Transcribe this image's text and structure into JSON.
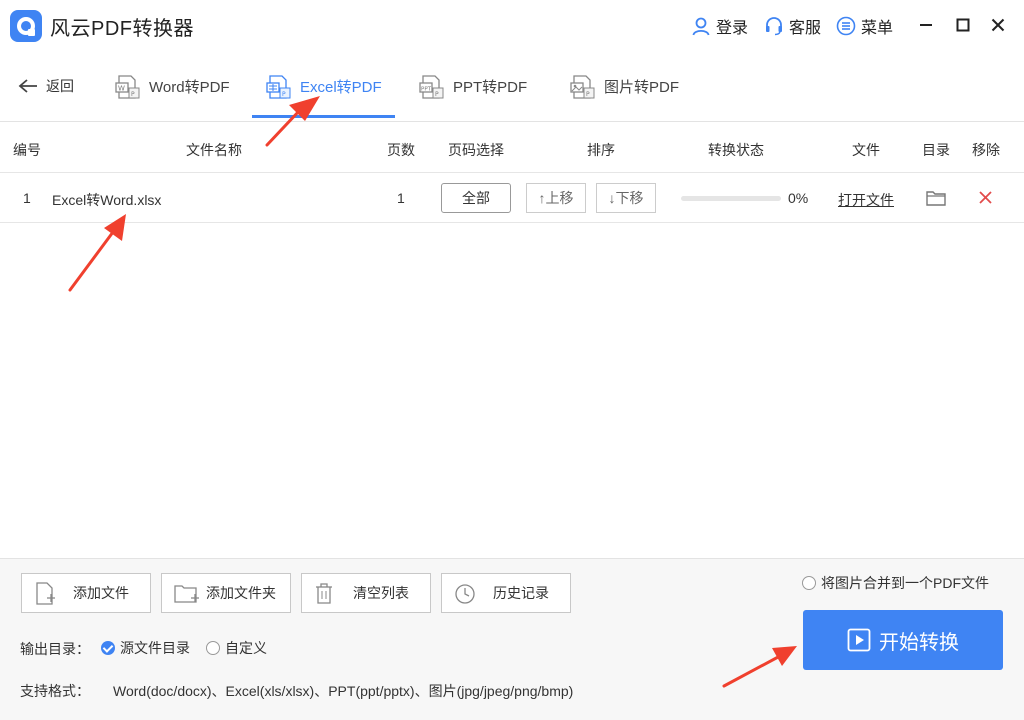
{
  "app": {
    "title": "风云PDF转换器"
  },
  "header": {
    "login": "登录",
    "service": "客服",
    "menu": "菜单"
  },
  "nav": {
    "back": "返回",
    "tabs": [
      {
        "label": "Word转PDF",
        "icon": "word-doc-icon",
        "active": false
      },
      {
        "label": "Excel转PDF",
        "icon": "excel-doc-icon",
        "active": true
      },
      {
        "label": "PPT转PDF",
        "icon": "ppt-doc-icon",
        "active": false
      },
      {
        "label": "图片转PDF",
        "icon": "image-doc-icon",
        "active": false
      }
    ]
  },
  "table": {
    "headers": {
      "index": "编号",
      "name": "文件名称",
      "pages": "页数",
      "page_select": "页码选择",
      "order": "排序",
      "status": "转换状态",
      "file": "文件",
      "dir": "目录",
      "remove": "移除"
    },
    "rows": [
      {
        "index": "1",
        "name": "Excel转Word.xlsx",
        "pages": "1",
        "page_select": "全部",
        "move_up": "↑上移",
        "move_down": "↓下移",
        "progress": 0,
        "progress_text": "0%",
        "open_file": "打开文件"
      }
    ]
  },
  "bottom": {
    "add_file": "添加文件",
    "add_folder": "添加文件夹",
    "clear_list": "清空列表",
    "history": "历史记录",
    "output_label": "输出目录：",
    "output_source": "源文件目录",
    "output_custom": "自定义",
    "formats_label": "支持格式：",
    "formats": "Word(doc/docx)、Excel(xls/xlsx)、PPT(ppt/pptx)、图片(jpg/jpeg/png/bmp)",
    "merge_images": "将图片合并到一个PDF文件",
    "start": "开始转换"
  },
  "colors": {
    "accent": "#3f84f3",
    "remove": "#e24b4b",
    "arrow": "#f0402e"
  }
}
